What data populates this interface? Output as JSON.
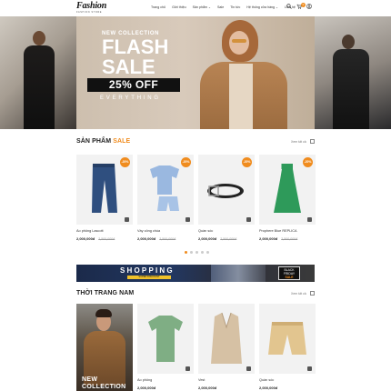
{
  "brand": {
    "name": "Fashion",
    "tagline": "FASHION STORE"
  },
  "nav": [
    "Trang chủ",
    "Giới thiệu",
    "Sản phẩm ⌄",
    "Sale",
    "Tin tức",
    "Hệ thống cửa hàng ⌄",
    "Liên hệ"
  ],
  "header_icons": [
    "search-icon",
    "cart-icon",
    "user-icon"
  ],
  "cart_count": "0",
  "hero": {
    "subtitle": "NEW COLLECTION",
    "title_line1": "FLASH",
    "title_line2": "SALE",
    "discount": "25% OFF",
    "tagline": "EVERYTHING"
  },
  "sale_section": {
    "title_main": "SẢN PHẨM ",
    "title_highlight": "SALE",
    "see_all": "Xem tất cả",
    "products": [
      {
        "name": "Áo phông Lascott",
        "price": "2,000,000đ",
        "old_price": "2,500,000đ",
        "badge": "-20%"
      },
      {
        "name": "Váy công chúa",
        "price": "2,000,000đ",
        "old_price": "2,500,000đ",
        "badge": "-20%"
      },
      {
        "name": "Quần sóc",
        "price": "2,000,000đ",
        "old_price": "2,500,000đ",
        "badge": "-20%"
      },
      {
        "name": "Prophere Blue REPLICA",
        "price": "2,000,000đ",
        "old_price": "2,500,000đ",
        "badge": "-20%"
      }
    ]
  },
  "banner": {
    "title": "SHOPPING",
    "subtitle": "SUPER DISCOUNT",
    "bf_line1": "BLACK",
    "bf_line2": "FRIDAY",
    "bf_line3": "SALE"
  },
  "men_section": {
    "title": "THỜI TRANG NAM",
    "see_all": "Xem tất cả",
    "promo_line1": "NEW",
    "promo_line2": "COLLECTION",
    "products": [
      {
        "name": "Áo phông",
        "price": "2,000,000đ"
      },
      {
        "name": "Vest",
        "price": "2,000,000đ"
      },
      {
        "name": "Quần sóc",
        "price": "2,000,000đ"
      }
    ]
  },
  "colors": {
    "accent": "#f08c1e",
    "dark": "#111111"
  }
}
